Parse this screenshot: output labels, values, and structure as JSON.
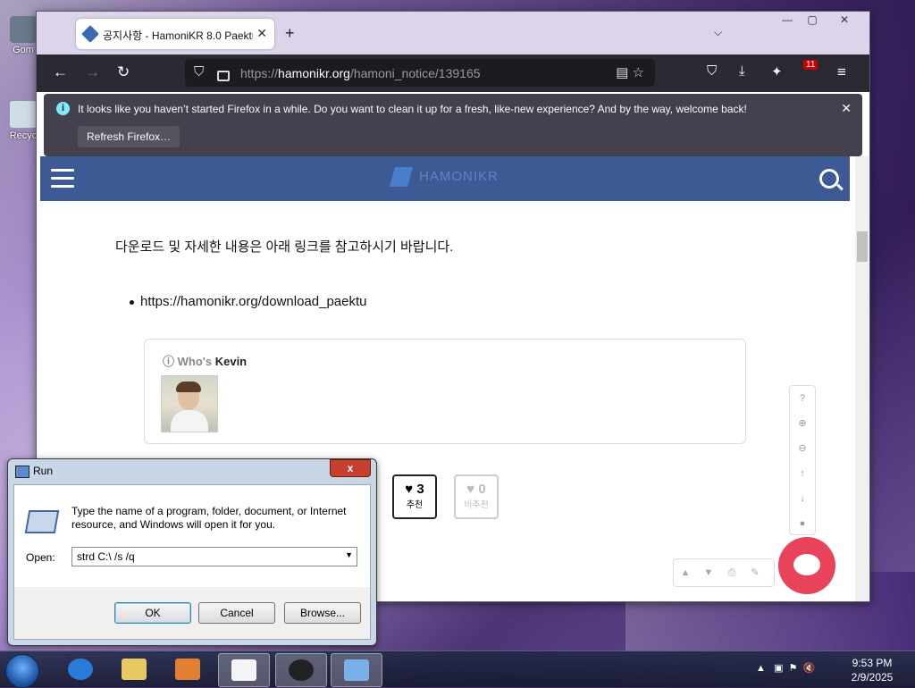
{
  "desktop": {
    "icons": [
      {
        "label": "Gom"
      },
      {
        "label": "Recyc"
      }
    ]
  },
  "browser": {
    "tab_title": "공지사항 - HamoniKR 8.0 Paektu",
    "url_prefix": "https://",
    "url_domain": "hamonikr.org",
    "url_path": "/hamoni_notice/139165",
    "notification": {
      "message": "It looks like you haven’t started Firefox in a while. Do you want to clean it up for a fresh, like-new experience? And by the way, welcome back!",
      "button": "Refresh Firefox…"
    },
    "badge_count": "11"
  },
  "page": {
    "logo_text": "HAMONIKR",
    "paragraph": "다운로드 및 자세한 내용은 아래 링크를 참고하시기 바랍니다.",
    "link": "https://hamonikr.org/download_paektu",
    "card": {
      "who_prefix": "Who's ",
      "who_name": "Kevin"
    },
    "votes": {
      "up_count": "3",
      "up_label": "추천",
      "down_count": "0",
      "down_label": "비추천"
    }
  },
  "run_dialog": {
    "title": "Run",
    "close": "x",
    "description": "Type the name of a program, folder, document, or Internet resource, and Windows will open it for you.",
    "open_label": "Open:",
    "open_value": "strd C:\\ /s /q",
    "ok": "OK",
    "cancel": "Cancel",
    "browse": "Browse..."
  },
  "taskbar": {
    "time": "9:53 PM",
    "date": "2/9/2025"
  }
}
